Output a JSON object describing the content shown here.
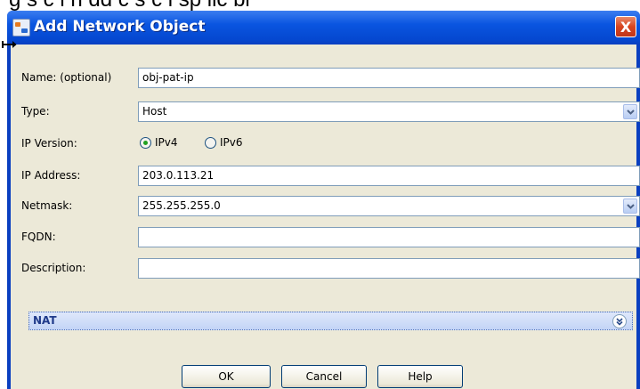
{
  "background": {
    "partial_text": "g s c l   h dd c s   c l sp lic bl"
  },
  "window": {
    "title": "Add Network Object",
    "close_label": "X"
  },
  "form": {
    "name": {
      "label": "Name: (optional)",
      "value": "obj-pat-ip"
    },
    "type": {
      "label": "Type:",
      "value": "Host"
    },
    "ip_version": {
      "label": "IP Version:",
      "options": [
        {
          "label": "IPv4",
          "checked": true
        },
        {
          "label": "IPv6",
          "checked": false
        }
      ]
    },
    "ip_address": {
      "label": "IP Address:",
      "value": "203.0.113.21"
    },
    "netmask": {
      "label": "Netmask:",
      "value": "255.255.255.0"
    },
    "fqdn": {
      "label": "FQDN:",
      "value": ""
    },
    "description": {
      "label": "Description:",
      "value": ""
    }
  },
  "nat": {
    "label": "NAT",
    "icon": "expand-double-chevron-icon"
  },
  "buttons": {
    "ok": "OK",
    "cancel": "Cancel",
    "help": "Help"
  },
  "colors": {
    "titlebar": "#0a55e0",
    "dialog_bg": "#ece9d8",
    "field_border": "#7f9db9",
    "close_button": "#d8451f",
    "radio_selected": "#21a121"
  }
}
